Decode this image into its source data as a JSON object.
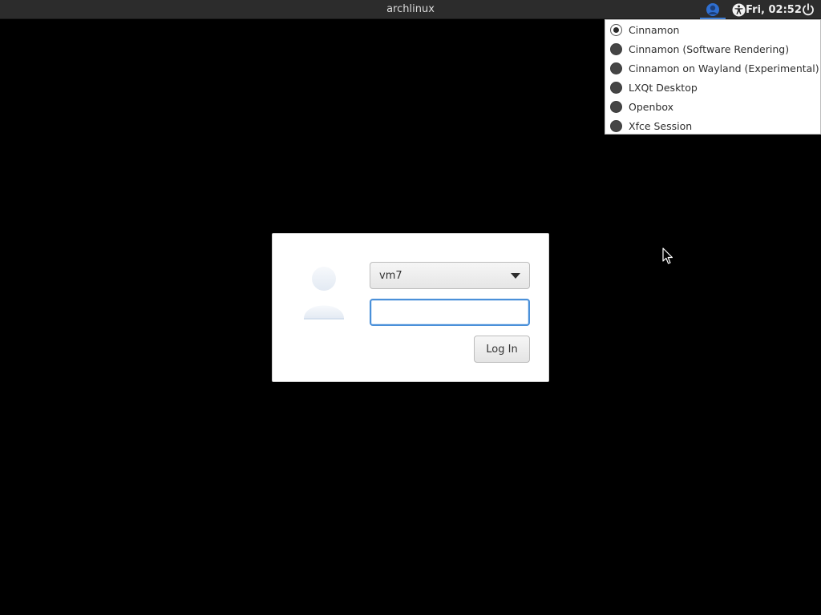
{
  "top_panel": {
    "hostname": "archlinux",
    "clock": "Fri, 02:52",
    "session_icon": "session-icon",
    "accessibility_icon": "accessibility-icon",
    "power_icon": "power-icon",
    "accent_color": "#3f7fd6"
  },
  "session_menu": {
    "items": [
      {
        "label": "Cinnamon",
        "selected": true
      },
      {
        "label": "Cinnamon (Software Rendering)",
        "selected": false
      },
      {
        "label": "Cinnamon on Wayland (Experimental)",
        "selected": false
      },
      {
        "label": "LXQt Desktop",
        "selected": false
      },
      {
        "label": "Openbox",
        "selected": false
      },
      {
        "label": "Xfce Session",
        "selected": false
      }
    ]
  },
  "login": {
    "avatar_icon": "user-avatar-icon",
    "selected_user": "vm7",
    "password_value": "",
    "login_label": "Log In",
    "focus_color": "#4a90d9"
  }
}
